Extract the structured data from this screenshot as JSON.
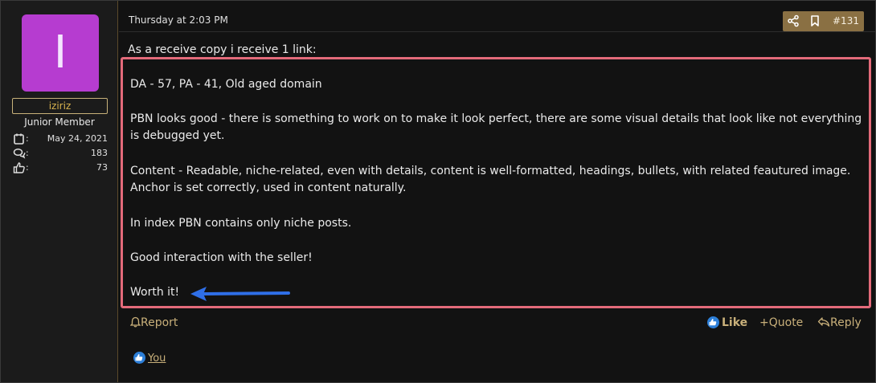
{
  "user": {
    "avatar_letter": "I",
    "avatar_color": "#b63cd0",
    "username": "iziriz",
    "title": "Junior Member",
    "stats": {
      "joined": "May 24, 2021",
      "messages": "183",
      "reactions": "73"
    }
  },
  "post": {
    "date": "Thursday at 2:03 PM",
    "number": "#131",
    "intro": "As a receive copy i receive 1 link:",
    "lines": {
      "l1": "DA - 57, PA - 41, Old aged domain",
      "l2": "PBN looks good - there is something to work on to make it look perfect, there are some visual details that look like not everything is debugged yet.",
      "l3": "Content - Readable, niche-related, even with details, content is well-formatted, headings, bullets, with related feautured image. Anchor is set correctly, used in content naturally.",
      "l4": "In index PBN contains only niche posts.",
      "l5": "Good interaction with the seller!",
      "l6": "Worth it!"
    }
  },
  "footer": {
    "report": "Report",
    "like": "Like",
    "quote": "Quote",
    "reply": "Reply",
    "liked_by": "You"
  },
  "colors": {
    "accent": "#c9b07a",
    "highlight_border": "#e36a7a",
    "arrow": "#2f6fe8",
    "badge": "#8a7043"
  }
}
